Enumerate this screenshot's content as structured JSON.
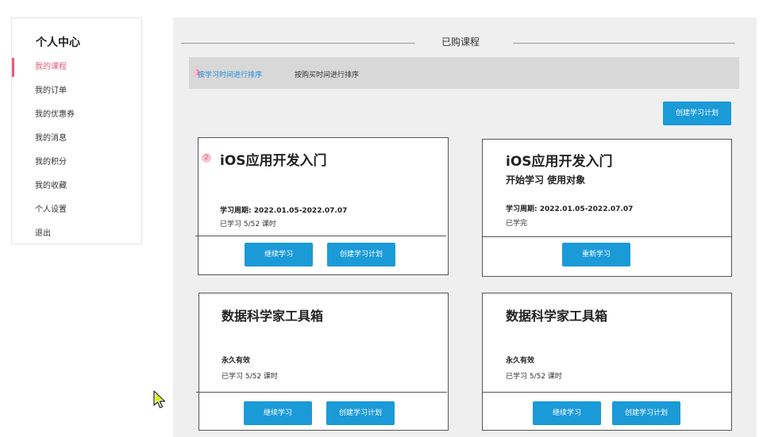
{
  "sidebar": {
    "title": "个人中心",
    "items": [
      {
        "label": "我的课程"
      },
      {
        "label": "我的订单"
      },
      {
        "label": "我的优惠券"
      },
      {
        "label": "我的消息"
      },
      {
        "label": "我的积分"
      },
      {
        "label": "我的收藏"
      },
      {
        "label": "个人设置"
      },
      {
        "label": "退出"
      }
    ]
  },
  "main": {
    "title": "已购课程",
    "sort": {
      "marker": "1",
      "by_study_time": "按学习时间进行排序",
      "by_purchase_time": "按购买时间进行排序"
    },
    "create_plan_label": "创建学习计划",
    "card_marker": "2",
    "cards": [
      {
        "title": "iOS应用开发入门",
        "line1": "学习周期: 2022.01.05-2022.07.07",
        "line2": "已学习   5/52 课时",
        "buttons": [
          "继续学习",
          "创建学习计划"
        ]
      },
      {
        "title": "iOS应用开发入门",
        "subtitle": "开始学习  使用对象",
        "line1": "学习周期: 2022.01.05-2022.07.07",
        "line2": "已学完",
        "buttons": [
          "重新学习"
        ]
      },
      {
        "title": "数据科学家工具箱",
        "line1": "永久有效",
        "line2": "已学习   5/52 课时",
        "buttons": [
          "继续学习",
          "创建学习计划"
        ]
      },
      {
        "title": "数据科学家工具箱",
        "line1": "永久有效",
        "line2": "已学习   5/52 课时",
        "buttons": [
          "继续学习",
          "创建学习计划"
        ]
      }
    ]
  },
  "colors": {
    "accent": "#e85b7a",
    "primary": "#1b9ad8",
    "link": "#1f8fd6"
  }
}
